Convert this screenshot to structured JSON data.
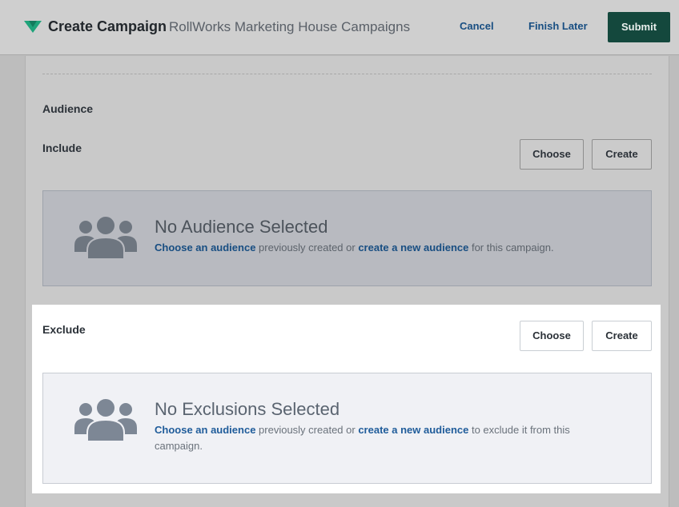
{
  "header": {
    "title": "Create Campaign",
    "subtitle": "RollWorks Marketing House Campaigns",
    "cancel_label": "Cancel",
    "finish_later_label": "Finish Later",
    "submit_label": "Submit",
    "logo_icon": "rollworks-logo-icon",
    "brand_color": "#1fa37a",
    "submit_color": "#14483d"
  },
  "section": {
    "audience_label": "Audience",
    "include": {
      "label": "Include",
      "choose_label": "Choose",
      "create_label": "Create",
      "empty_title": "No Audience Selected",
      "link_choose": "Choose an audience",
      "text_mid": " previously created or ",
      "link_create": "create a new audience",
      "text_end": " for this campaign."
    },
    "exclude": {
      "label": "Exclude",
      "choose_label": "Choose",
      "create_label": "Create",
      "empty_title": "No Exclusions Selected",
      "link_choose": "Choose an audience",
      "text_mid": " previously created or ",
      "link_create": "create a new audience",
      "text_end": " to exclude it from this campaign."
    },
    "empty_icon": "users-group-icon",
    "link_color": "#184e82"
  }
}
